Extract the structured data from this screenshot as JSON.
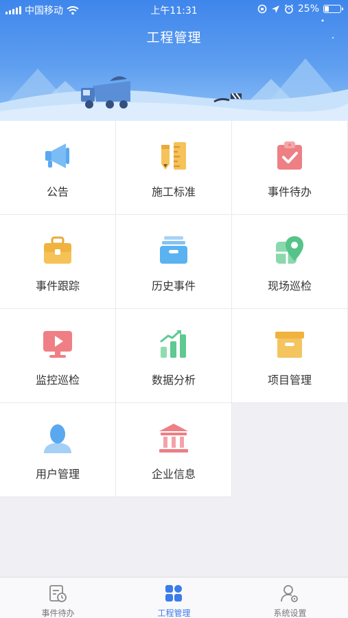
{
  "status_bar": {
    "carrier": "中国移动",
    "time": "上午11:31",
    "battery": "25%"
  },
  "header": {
    "title": "工程管理"
  },
  "menu": [
    {
      "label": "公告",
      "icon": "megaphone-icon"
    },
    {
      "label": "施工标准",
      "icon": "pencil-ruler-icon"
    },
    {
      "label": "事件待办",
      "icon": "clipboard-check-icon"
    },
    {
      "label": "事件跟踪",
      "icon": "briefcase-icon"
    },
    {
      "label": "历史事件",
      "icon": "archive-tray-icon"
    },
    {
      "label": "现场巡检",
      "icon": "map-pin-icon"
    },
    {
      "label": "监控巡检",
      "icon": "monitor-play-icon"
    },
    {
      "label": "数据分析",
      "icon": "bar-chart-icon"
    },
    {
      "label": "项目管理",
      "icon": "box-icon"
    },
    {
      "label": "用户管理",
      "icon": "user-icon"
    },
    {
      "label": "企业信息",
      "icon": "bank-building-icon"
    }
  ],
  "tabbar": {
    "items": [
      {
        "label": "事件待办",
        "icon": "clipboard-clock-icon",
        "active": false
      },
      {
        "label": "工程管理",
        "icon": "grid-apps-icon",
        "active": true
      },
      {
        "label": "系统设置",
        "icon": "user-gear-icon",
        "active": false
      }
    ]
  },
  "colors": {
    "header_blue": "#3f86ec",
    "tab_active": "#3b7ce8",
    "megaphone": "#5aa8f0",
    "pencil_yellow": "#f5c35a",
    "clipboard_red": "#ee7f84",
    "briefcase_yellow": "#f4c257",
    "tray_blue": "#5bb2f0",
    "map_green": "#56c488",
    "monitor_red": "#ef7f85",
    "chart_green": "#5fc98f",
    "box_yellow": "#f4c45f",
    "user_blue": "#5aa9ef",
    "bank_red": "#ee7f85"
  }
}
